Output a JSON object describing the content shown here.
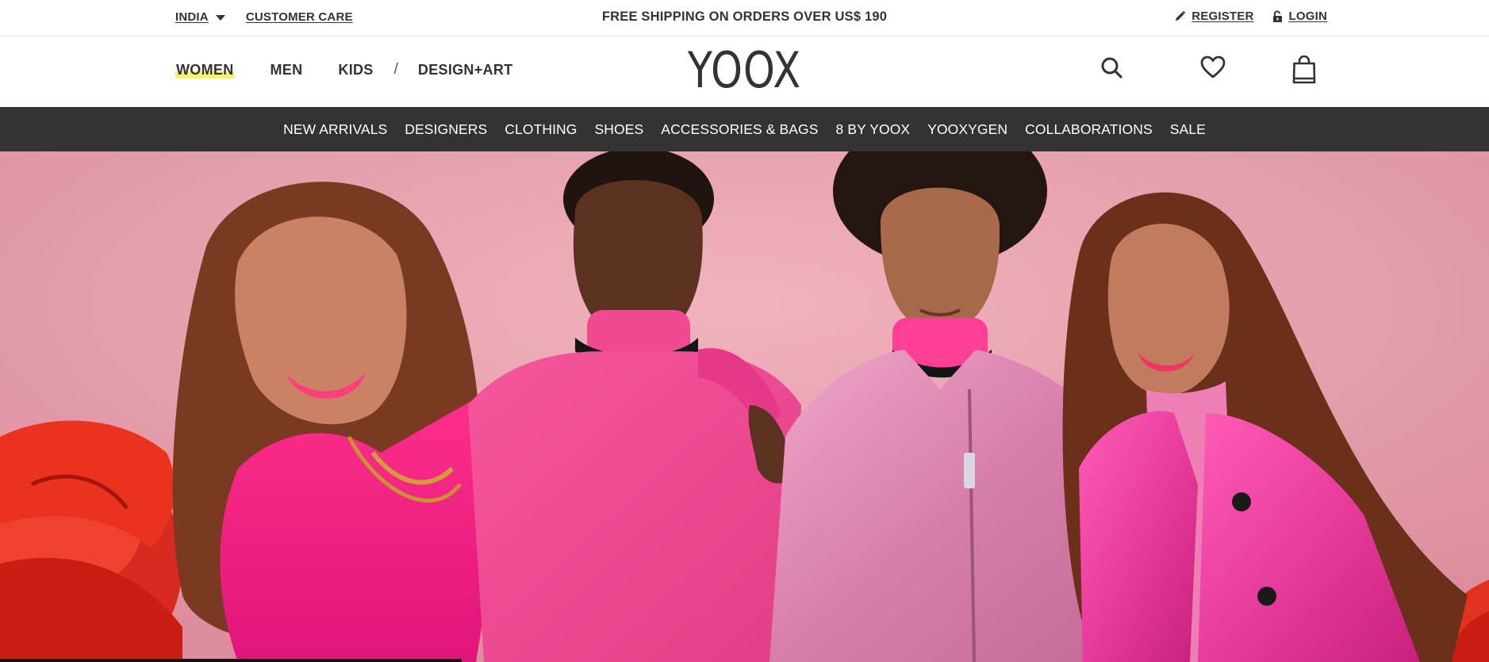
{
  "topbar": {
    "country": "INDIA",
    "customer_care": "CUSTOMER CARE",
    "shipping": "FREE SHIPPING ON ORDERS OVER US$ 190",
    "register": "REGISTER",
    "login": "LOGIN",
    "register_icon": "pencil-icon",
    "login_icon": "unlock-icon"
  },
  "header": {
    "logo": "YOOX",
    "gender_nav": [
      {
        "label": "WOMEN",
        "active": true
      },
      {
        "label": "MEN",
        "active": false
      },
      {
        "label": "KIDS",
        "active": false
      }
    ],
    "separator": "/",
    "design_art": "DESIGN+ART",
    "icons": [
      "search-icon",
      "heart-icon",
      "shopping-bag-icon"
    ],
    "active_highlight_color": "#f6f17a"
  },
  "catnav": {
    "background": "#333333",
    "items": [
      "NEW ARRIVALS",
      "DESIGNERS",
      "CLOTHING",
      "SHOES",
      "ACCESSORIES & BAGS",
      "8 BY YOOX",
      "YOOXYGEN",
      "COLLABORATIONS",
      "SALE"
    ]
  },
  "hero": {
    "background_color": "#e8a3ae"
  }
}
